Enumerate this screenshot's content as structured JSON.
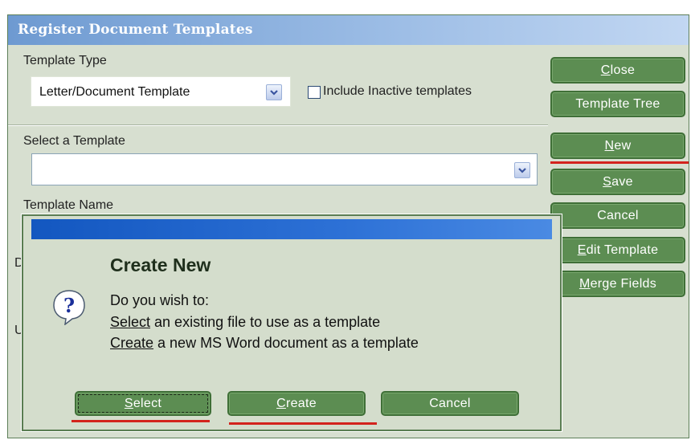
{
  "window": {
    "title": "Register Document Templates"
  },
  "template_type": {
    "label": "Template Type",
    "value": "Letter/Document Template",
    "include_inactive_label": "Include Inactive templates",
    "include_inactive_checked": false
  },
  "select_template": {
    "label": "Select a Template",
    "value": ""
  },
  "template_name": {
    "label": "Template Name"
  },
  "partial_labels": {
    "first": "D",
    "second": "U"
  },
  "buttons": {
    "close": {
      "mnemonic": "C",
      "rest": "lose"
    },
    "template_tree": "Template Tree",
    "new": {
      "mnemonic": "N",
      "rest": "ew"
    },
    "save": {
      "mnemonic": "S",
      "rest": "ave"
    },
    "cancel": "Cancel",
    "edit_template": {
      "mnemonic": "E",
      "rest": "dit Template"
    },
    "merge_fields": {
      "mnemonic": "M",
      "rest": "erge Fields"
    }
  },
  "dialog": {
    "heading": "Create New",
    "prompt": "Do you wish to:",
    "option_select": {
      "keyword": "Select",
      "text": " an existing file to use as a template"
    },
    "option_create": {
      "keyword": "Create",
      "text": " a new MS Word document as a template"
    },
    "buttons": {
      "select": {
        "mnemonic": "S",
        "rest": "elect"
      },
      "create": {
        "mnemonic": "C",
        "rest": "reate"
      },
      "cancel": "Cancel"
    },
    "icon": "question-icon"
  },
  "colors": {
    "window_bg": "#d7dfd0",
    "button_green": "#5c8d52",
    "title_blue": "#6e9ad1",
    "dialog_title_blue": "#1357c0",
    "highlight_red": "#d3231d"
  }
}
